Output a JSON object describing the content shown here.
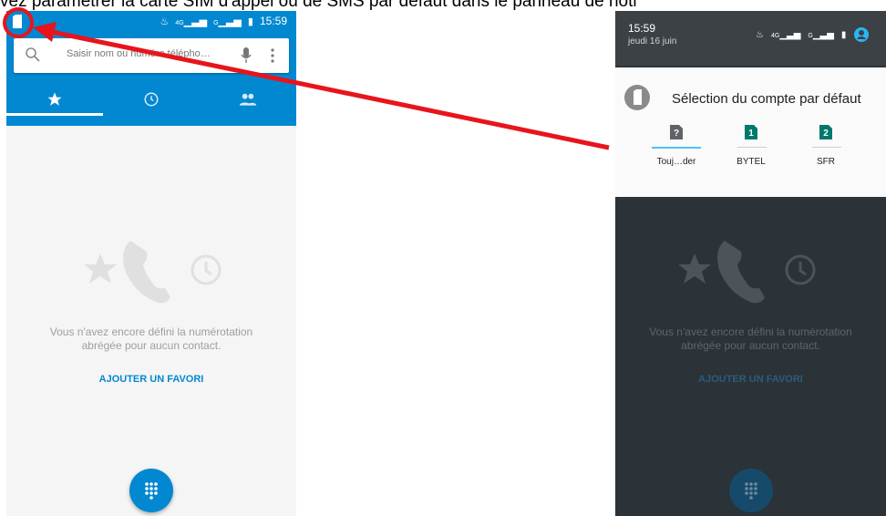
{
  "caption": "vez paramétrer la carte SIM d'appel ou de SMS par défaut dans le panneau de noti",
  "left_phone": {
    "status_bar": {
      "time": "15:59",
      "signal1": "4G",
      "signal2": "G"
    },
    "search": {
      "placeholder": "Saisir nom ou numéro télépho…"
    },
    "tabs": [
      {
        "icon": "star-icon"
      },
      {
        "icon": "clock-icon"
      },
      {
        "icon": "people-icon"
      }
    ],
    "empty_state": {
      "line1": "Vous n'avez encore défini la numérotation",
      "line2": "abrégée pour aucun contact."
    },
    "add_favorite": "AJOUTER UN FAVORI"
  },
  "right_phone": {
    "shade": {
      "time": "15:59",
      "date": "jeudi 16 juin",
      "signal1": "4G",
      "signal2": "G"
    },
    "card": {
      "title": "Sélection du compte par défaut",
      "options": [
        {
          "label": "Touj…der",
          "badge": "?",
          "badge_color": "#5f6368"
        },
        {
          "label": "BYTEL",
          "badge": "1",
          "badge_color": "#00796b"
        },
        {
          "label": "SFR",
          "badge": "2",
          "badge_color": "#00796b"
        }
      ]
    },
    "empty_state": {
      "line1": "Vous n'avez encore défini la numérotation",
      "line2": "abrégée pour aucun contact."
    },
    "add_favorite": "AJOUTER UN FAVORI"
  },
  "colors": {
    "accent_blue": "#0288d1",
    "annotation_red": "#e8141c"
  }
}
